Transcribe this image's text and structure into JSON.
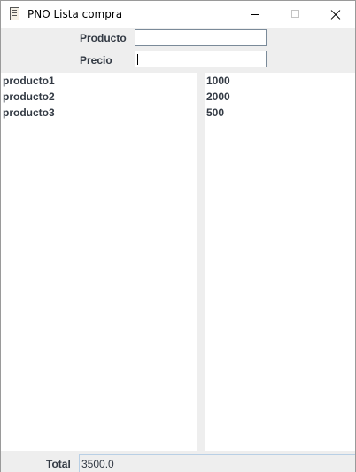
{
  "window": {
    "title": "PNO Lista compra",
    "icon": "document-icon"
  },
  "form": {
    "producto_label": "Producto",
    "producto_value": "",
    "precio_label": "Precio",
    "precio_value": ""
  },
  "productos": [
    "producto1",
    "producto2",
    "producto3"
  ],
  "precios": [
    "1000",
    "2000",
    "500"
  ],
  "footer": {
    "total_label": "Total",
    "total_value": "3500.0"
  }
}
